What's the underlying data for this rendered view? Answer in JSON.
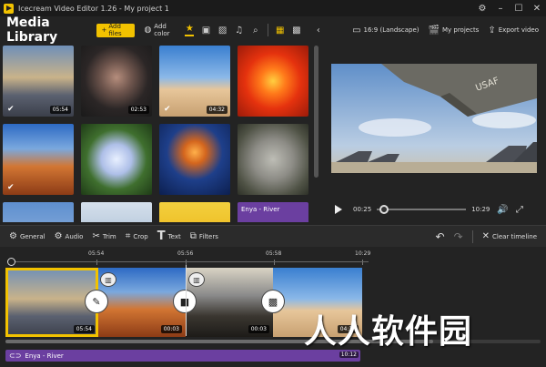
{
  "window": {
    "title": "Icecream Video Editor 1.26 - My project 1"
  },
  "library": {
    "title": "Media Library",
    "add_files": "Add files",
    "add_color": "Add color",
    "items": [
      {
        "duration": "05:54",
        "checked": true
      },
      {
        "duration": "02:53",
        "checked": false
      },
      {
        "duration": "04:32",
        "checked": true
      },
      {
        "duration": "",
        "checked": false
      },
      {
        "duration": "",
        "checked": true
      },
      {
        "duration": "",
        "checked": false
      },
      {
        "duration": "",
        "checked": false
      },
      {
        "duration": "",
        "checked": false
      }
    ],
    "audio_item": "Enya - River"
  },
  "preview": {
    "aspect": "16:9 (Landscape)",
    "my_projects": "My projects",
    "export": "Export video",
    "current_time": "00:25",
    "total_time": "10:29",
    "progress": 0.03
  },
  "toolbar": {
    "general": "General",
    "audio": "Audio",
    "trim": "Trim",
    "crop": "Crop",
    "text": "Text",
    "filters": "Filters",
    "clear": "Clear timeline"
  },
  "timeline": {
    "ticks": [
      "05:54",
      "05:56",
      "05:58",
      "10:29"
    ],
    "clips": [
      {
        "duration": "05:54"
      },
      {
        "duration": "00:03"
      },
      {
        "duration": "00:03"
      },
      {
        "duration": "04:32"
      }
    ],
    "audio": {
      "label": "Enya - River",
      "duration": "10:12"
    }
  },
  "watermark": "人人软件园"
}
